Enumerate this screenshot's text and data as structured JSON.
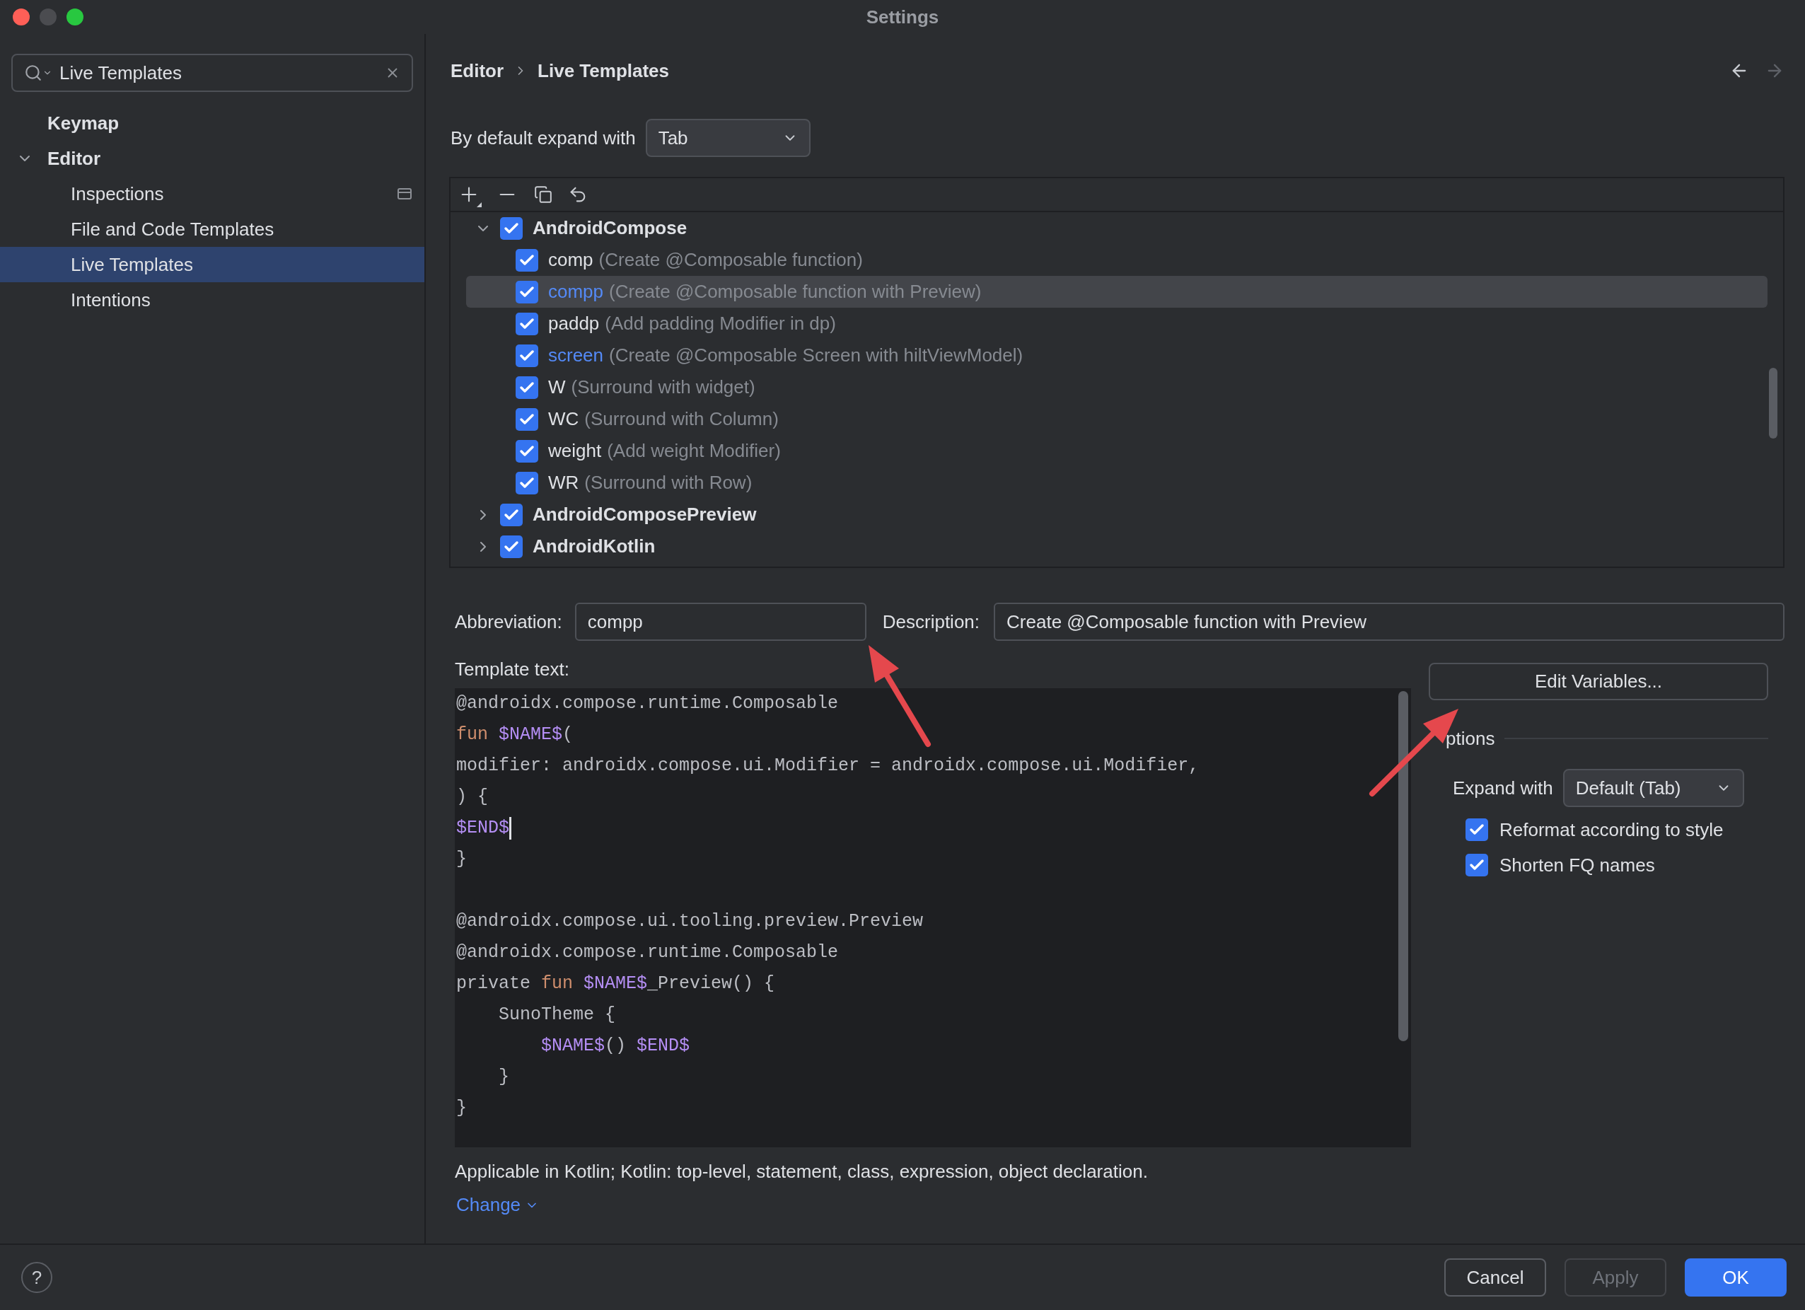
{
  "window": {
    "title": "Settings"
  },
  "search": {
    "value": "Live Templates"
  },
  "sidebar": {
    "items": [
      {
        "label": "Keymap",
        "selected": false
      },
      {
        "label": "Editor",
        "selected": false,
        "expanded": true,
        "children": [
          {
            "label": "Inspections",
            "selected": false
          },
          {
            "label": "File and Code Templates",
            "selected": false
          },
          {
            "label": "Live Templates",
            "selected": true
          },
          {
            "label": "Intentions",
            "selected": false
          }
        ]
      }
    ]
  },
  "breadcrumb": [
    "Editor",
    "Live Templates"
  ],
  "default_expand": {
    "label": "By default expand with",
    "value": "Tab"
  },
  "templates": [
    {
      "name": "AndroidCompose",
      "expanded": true,
      "checked": true,
      "children": [
        {
          "abbreviation": "comp",
          "description": "(Create @Composable function)",
          "checked": true,
          "selected": false,
          "modified": false
        },
        {
          "abbreviation": "compp",
          "description": "(Create @Composable function with Preview)",
          "checked": true,
          "selected": true,
          "modified": true
        },
        {
          "abbreviation": "paddp",
          "description": "(Add padding Modifier in dp)",
          "checked": true,
          "selected": false,
          "modified": false
        },
        {
          "abbreviation": "screen",
          "description": "(Create @Composable Screen with hiltViewModel)",
          "checked": true,
          "selected": false,
          "modified": true
        },
        {
          "abbreviation": "W",
          "description": "(Surround with widget)",
          "checked": true,
          "selected": false,
          "modified": false
        },
        {
          "abbreviation": "WC",
          "description": "(Surround with Column)",
          "checked": true,
          "selected": false,
          "modified": false
        },
        {
          "abbreviation": "weight",
          "description": "(Add weight Modifier)",
          "checked": true,
          "selected": false,
          "modified": false
        },
        {
          "abbreviation": "WR",
          "description": "(Surround with Row)",
          "checked": true,
          "selected": false,
          "modified": false
        }
      ]
    },
    {
      "name": "AndroidComposePreview",
      "expanded": false,
      "checked": true
    },
    {
      "name": "AndroidKotlin",
      "expanded": false,
      "checked": true
    }
  ],
  "abbreviation": {
    "label": "Abbreviation:",
    "value": "compp"
  },
  "description": {
    "label": "Description:",
    "value": "Create @Composable function with Preview"
  },
  "template_text": {
    "label": "Template text:",
    "lines": [
      [
        {
          "text": "@androidx.compose.runtime.Composable",
          "kind": "plain"
        }
      ],
      [
        {
          "text": "fun ",
          "kind": "keyword"
        },
        {
          "text": "$NAME$",
          "kind": "variable"
        },
        {
          "text": "(",
          "kind": "plain"
        }
      ],
      [
        {
          "text": "modifier: androidx.compose.ui.Modifier = androidx.compose.ui.Modifier,",
          "kind": "plain"
        }
      ],
      [
        {
          "text": ") {",
          "kind": "plain"
        }
      ],
      [
        {
          "text": "$END$",
          "kind": "variable",
          "caret": true
        }
      ],
      [
        {
          "text": "}",
          "kind": "plain"
        }
      ],
      [
        {
          "kind": "blank"
        }
      ],
      [
        {
          "text": "@androidx.compose.ui.tooling.preview.Preview",
          "kind": "plain"
        }
      ],
      [
        {
          "text": "@androidx.compose.runtime.Composable",
          "kind": "plain"
        }
      ],
      [
        {
          "text": "private ",
          "kind": "plain"
        },
        {
          "text": "fun ",
          "kind": "keyword"
        },
        {
          "text": "$NAME$",
          "kind": "variable"
        },
        {
          "text": "_Preview() {",
          "kind": "plain"
        }
      ],
      [
        {
          "text": "    SunoTheme {",
          "kind": "plain"
        }
      ],
      [
        {
          "text": "        $NAME$",
          "kind": "variable"
        },
        {
          "text": "() ",
          "kind": "plain"
        },
        {
          "text": "$END$",
          "kind": "variable"
        }
      ],
      [
        {
          "text": "    }",
          "kind": "plain"
        }
      ],
      [
        {
          "text": "}",
          "kind": "plain"
        }
      ]
    ]
  },
  "edit_variables": "Edit Variables...",
  "options": {
    "title": "ptions",
    "expand_label": "Expand with",
    "expand_value": "Default (Tab)",
    "checkboxes": [
      {
        "label": "Reformat according to style",
        "checked": true
      },
      {
        "label": "Shorten FQ names",
        "checked": true
      }
    ]
  },
  "applicable": "Applicable in Kotlin; Kotlin: top-level, statement, class, expression, object declaration.",
  "change_link": "Change",
  "help_label": "?",
  "buttons": [
    {
      "label": "Cancel",
      "kind": "secondary"
    },
    {
      "label": "Apply",
      "kind": "disabled"
    },
    {
      "label": "OK",
      "kind": "primary"
    }
  ]
}
